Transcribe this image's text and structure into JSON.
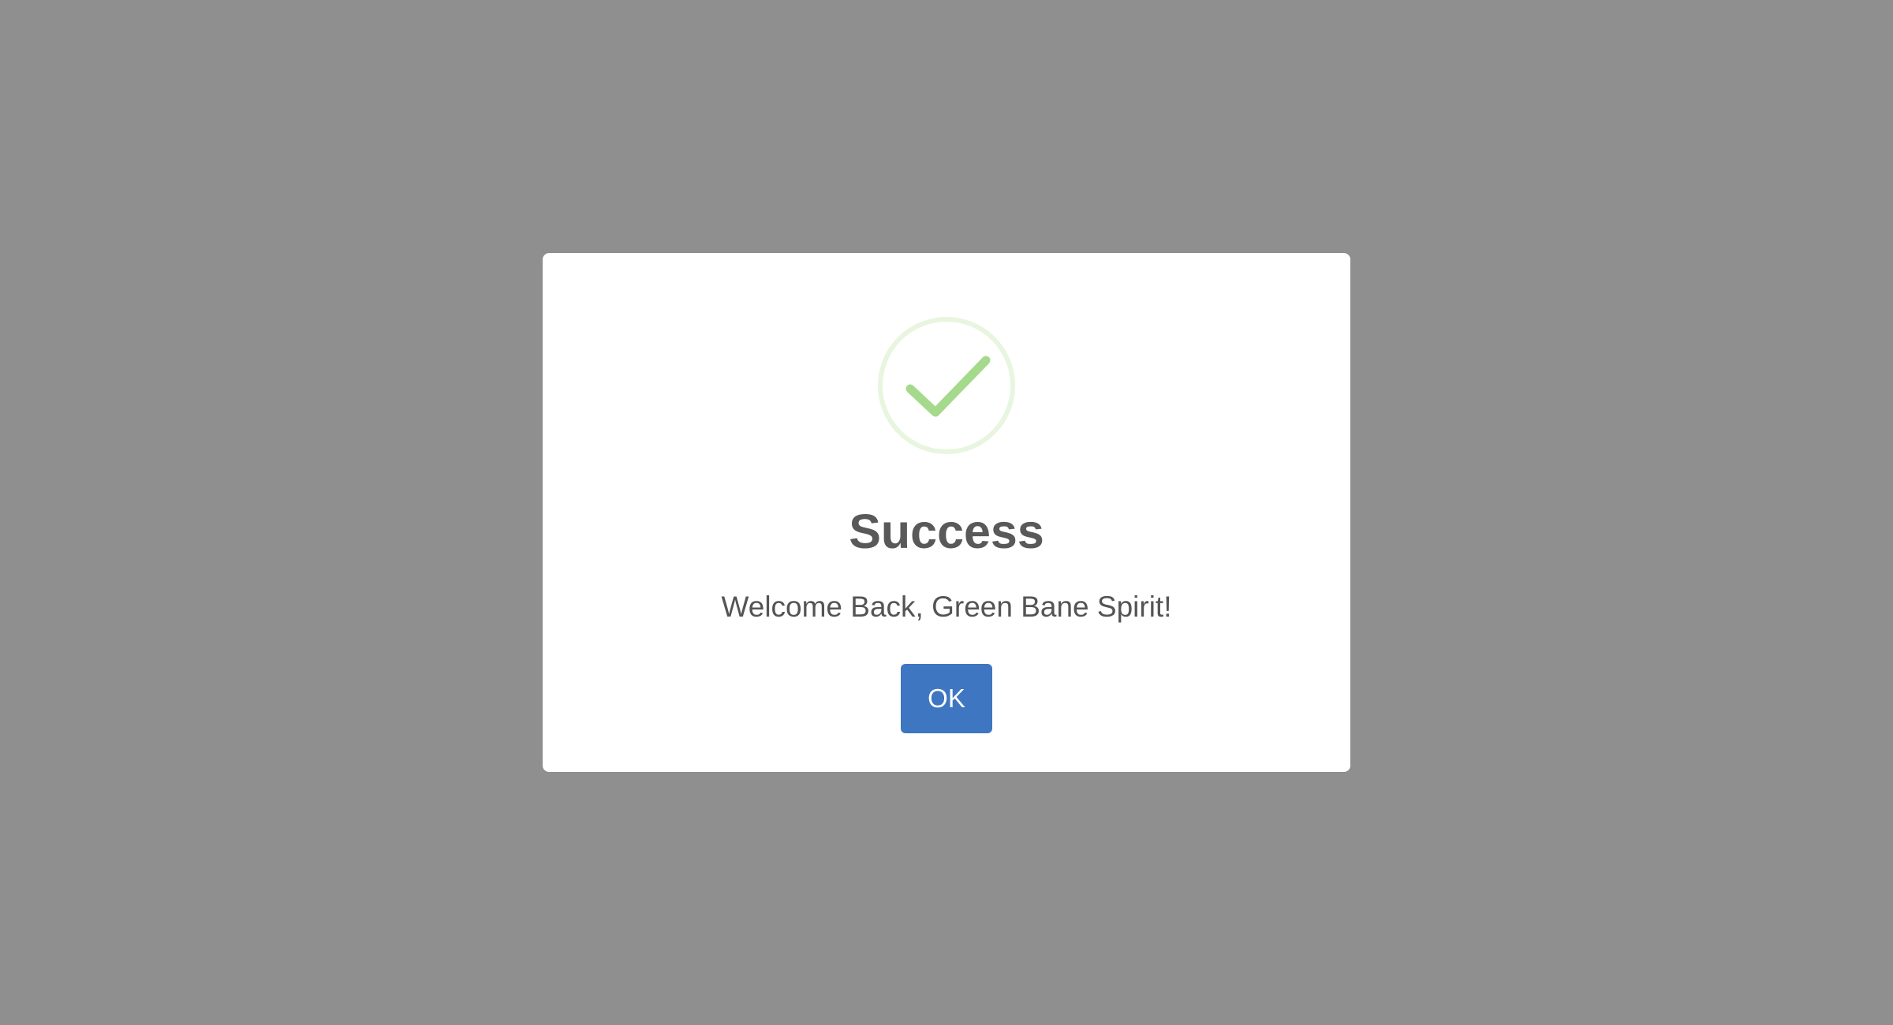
{
  "dialog": {
    "icon": "success-check-icon",
    "title": "Success",
    "message": "Welcome Back, Green Bane Spirit!",
    "confirm_label": "OK"
  },
  "colors": {
    "backdrop": "#8f8f8f",
    "dialog_background": "#ffffff",
    "title_text": "#595959",
    "message_text": "#545454",
    "success_ring": "#e8f5df",
    "success_check": "#a5d98b",
    "button_background": "#3e76c1",
    "button_text": "#ffffff"
  }
}
